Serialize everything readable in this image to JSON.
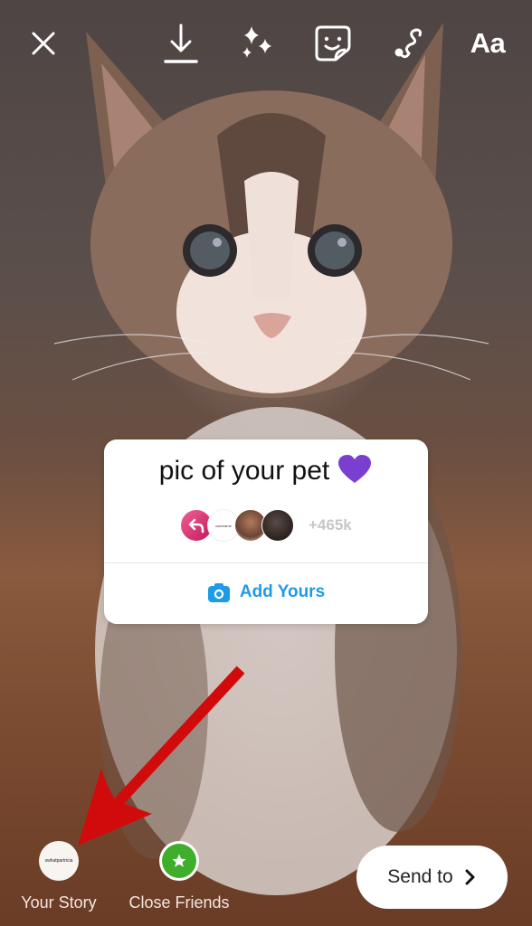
{
  "toolbar": {
    "close_icon": "close-icon",
    "download_icon": "download-icon",
    "effects_icon": "sparkles-icon",
    "sticker_icon": "sticker-icon",
    "draw_icon": "draw-squiggle-icon",
    "text_label": "Aa"
  },
  "background": {
    "description": "kitten photo"
  },
  "sticker": {
    "title": "pic of your pet",
    "emoji": "purple-heart",
    "heart_color": "#7a3fd1",
    "participants": [
      {
        "type": "reply-icon"
      },
      {
        "type": "text-avatar",
        "label": "username"
      },
      {
        "type": "photo"
      },
      {
        "type": "photo"
      }
    ],
    "count": "+465k",
    "action_label": "Add Yours",
    "action_color": "#1e9be6"
  },
  "annotation": {
    "arrow_color": "#d10b0b"
  },
  "bottom": {
    "your_story": {
      "label": "Your Story",
      "avatar_text": "swhatpartricia"
    },
    "close_friends": {
      "label": "Close Friends",
      "color": "#3fae2a"
    },
    "send": {
      "label": "Send to",
      "chevron": "›"
    }
  }
}
